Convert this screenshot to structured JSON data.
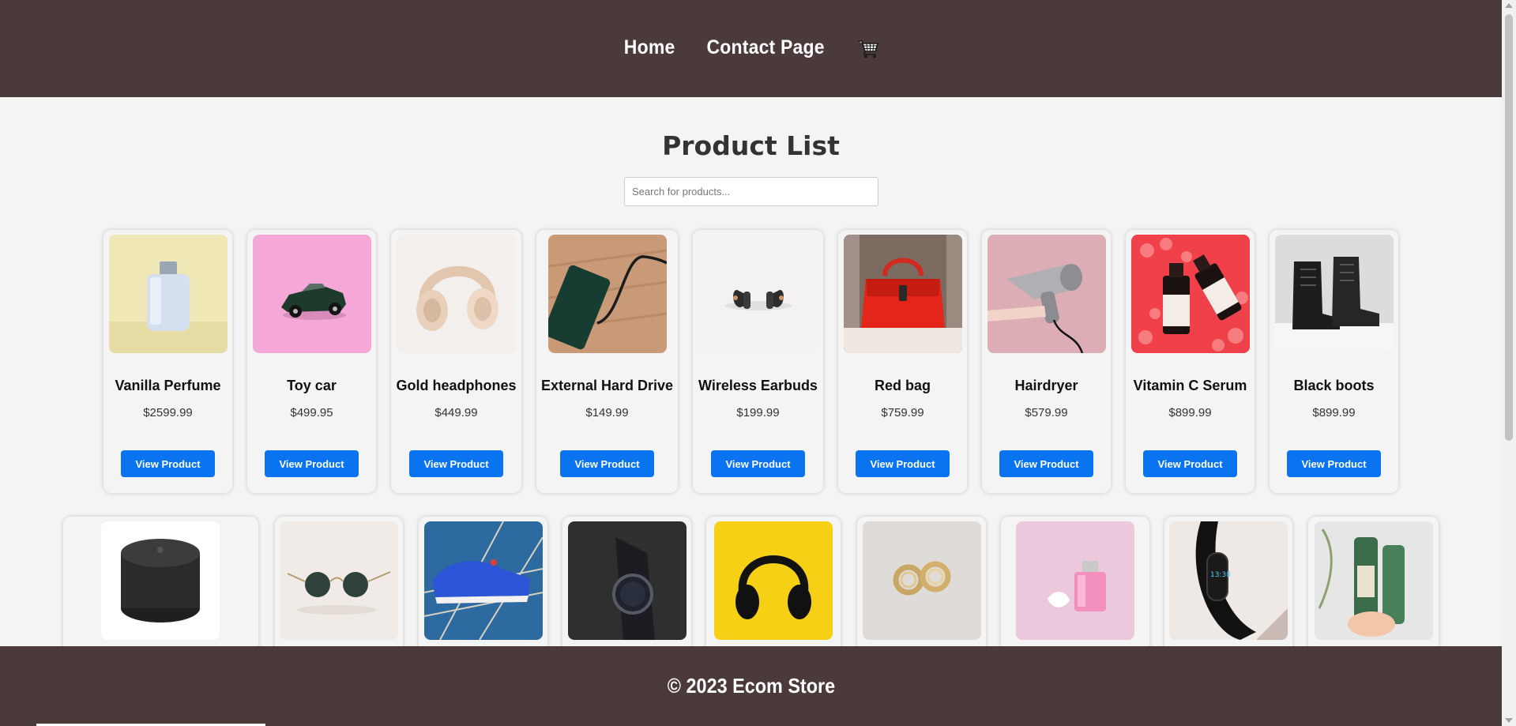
{
  "header": {
    "nav": [
      {
        "label": "Home"
      },
      {
        "label": "Contact Page"
      }
    ],
    "cart_icon": "cart-icon"
  },
  "main": {
    "title": "Product List",
    "search_placeholder": "Search for products..."
  },
  "products_row1": [
    {
      "name": "Vanilla Perfume",
      "price": "$2599.99",
      "button": "View Product",
      "image": "perfume-bottle"
    },
    {
      "name": "Toy car",
      "price": "$499.95",
      "button": "View Product",
      "image": "toy-car"
    },
    {
      "name": "Gold headphones",
      "price": "$449.99",
      "button": "View Product",
      "image": "gold-headphones"
    },
    {
      "name": "External Hard Drive",
      "price": "$149.99",
      "button": "View Product",
      "image": "hard-drive"
    },
    {
      "name": "Wireless Earbuds",
      "price": "$199.99",
      "button": "View Product",
      "image": "earbuds"
    },
    {
      "name": "Red bag",
      "price": "$759.99",
      "button": "View Product",
      "image": "red-bag"
    },
    {
      "name": "Hairdryer",
      "price": "$579.99",
      "button": "View Product",
      "image": "hairdryer"
    },
    {
      "name": "Vitamin C Serum",
      "price": "$899.99",
      "button": "View Product",
      "image": "serum"
    },
    {
      "name": "Black boots",
      "price": "$899.99",
      "button": "View Product",
      "image": "black-boots"
    }
  ],
  "products_row2": [
    {
      "image": "speaker"
    },
    {
      "image": "sunglasses"
    },
    {
      "image": "sneakers"
    },
    {
      "image": "watch"
    },
    {
      "image": "yellow-headphones"
    },
    {
      "image": "earrings"
    },
    {
      "image": "pink-perfume"
    },
    {
      "image": "fitness-band"
    },
    {
      "image": "shampoo-bottle"
    }
  ],
  "footer": {
    "text": "© 2023 Ecom Store"
  },
  "colors": {
    "header_bg": "#4b3a3a",
    "page_bg": "#f4f4f4",
    "button": "#0a74f0"
  }
}
